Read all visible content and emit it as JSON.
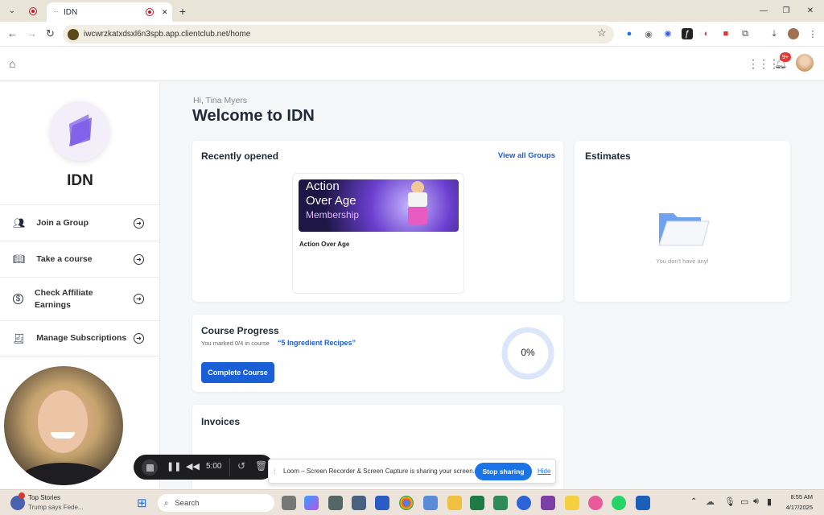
{
  "browser": {
    "tab_title": "IDN",
    "url": "iwcwrzkatxdsxl6n3spb.app.clientclub.net/home",
    "new_tab": "+",
    "close_tab": "✕"
  },
  "header": {
    "notification_count": "9+"
  },
  "sidebar": {
    "brand": "IDN",
    "items": [
      {
        "label": "Join a Group",
        "icon": "users-icon"
      },
      {
        "label": "Take a course",
        "icon": "book-icon"
      },
      {
        "label": "Check Affiliate Earnings",
        "icon": "dollar-icon"
      },
      {
        "label": "Manage Subscriptions",
        "icon": "receipt-icon"
      }
    ]
  },
  "main": {
    "greeting": "Hi, Tina Myers",
    "title": "Welcome to IDN",
    "recent": {
      "title": "Recently opened",
      "view_all": "View all Groups",
      "course_banner_line1": "Action",
      "course_banner_line2": "Over Age",
      "course_banner_line3": "Membership",
      "course_name": "Action Over Age"
    },
    "estimates": {
      "title": "Estimates",
      "empty_text": "You don't have any!"
    },
    "progress": {
      "title": "Course Progress",
      "subtitle": "You marked 0/4 in course",
      "course_link": "“5 Ingredient Recipes”",
      "button": "Complete Course",
      "percent_label": "0%",
      "percent": 0
    },
    "invoices": {
      "title": "Invoices"
    }
  },
  "recorder": {
    "timer": "5:00"
  },
  "loom_banner": {
    "message": "Loom – Screen Recorder & Screen Capture is sharing your screen.",
    "stop_button": "Stop sharing",
    "hide_link": "Hide"
  },
  "taskbar": {
    "news_title": "Top Stories",
    "news_sub": "Trump says Fede...",
    "search_placeholder": "Search",
    "time": "8:55 AM",
    "date": "4/17/2025"
  },
  "colors": {
    "accent": "#1a5fd6",
    "brand_purple": "#7c5ce6",
    "progress_ring": "#dbe6fb"
  }
}
